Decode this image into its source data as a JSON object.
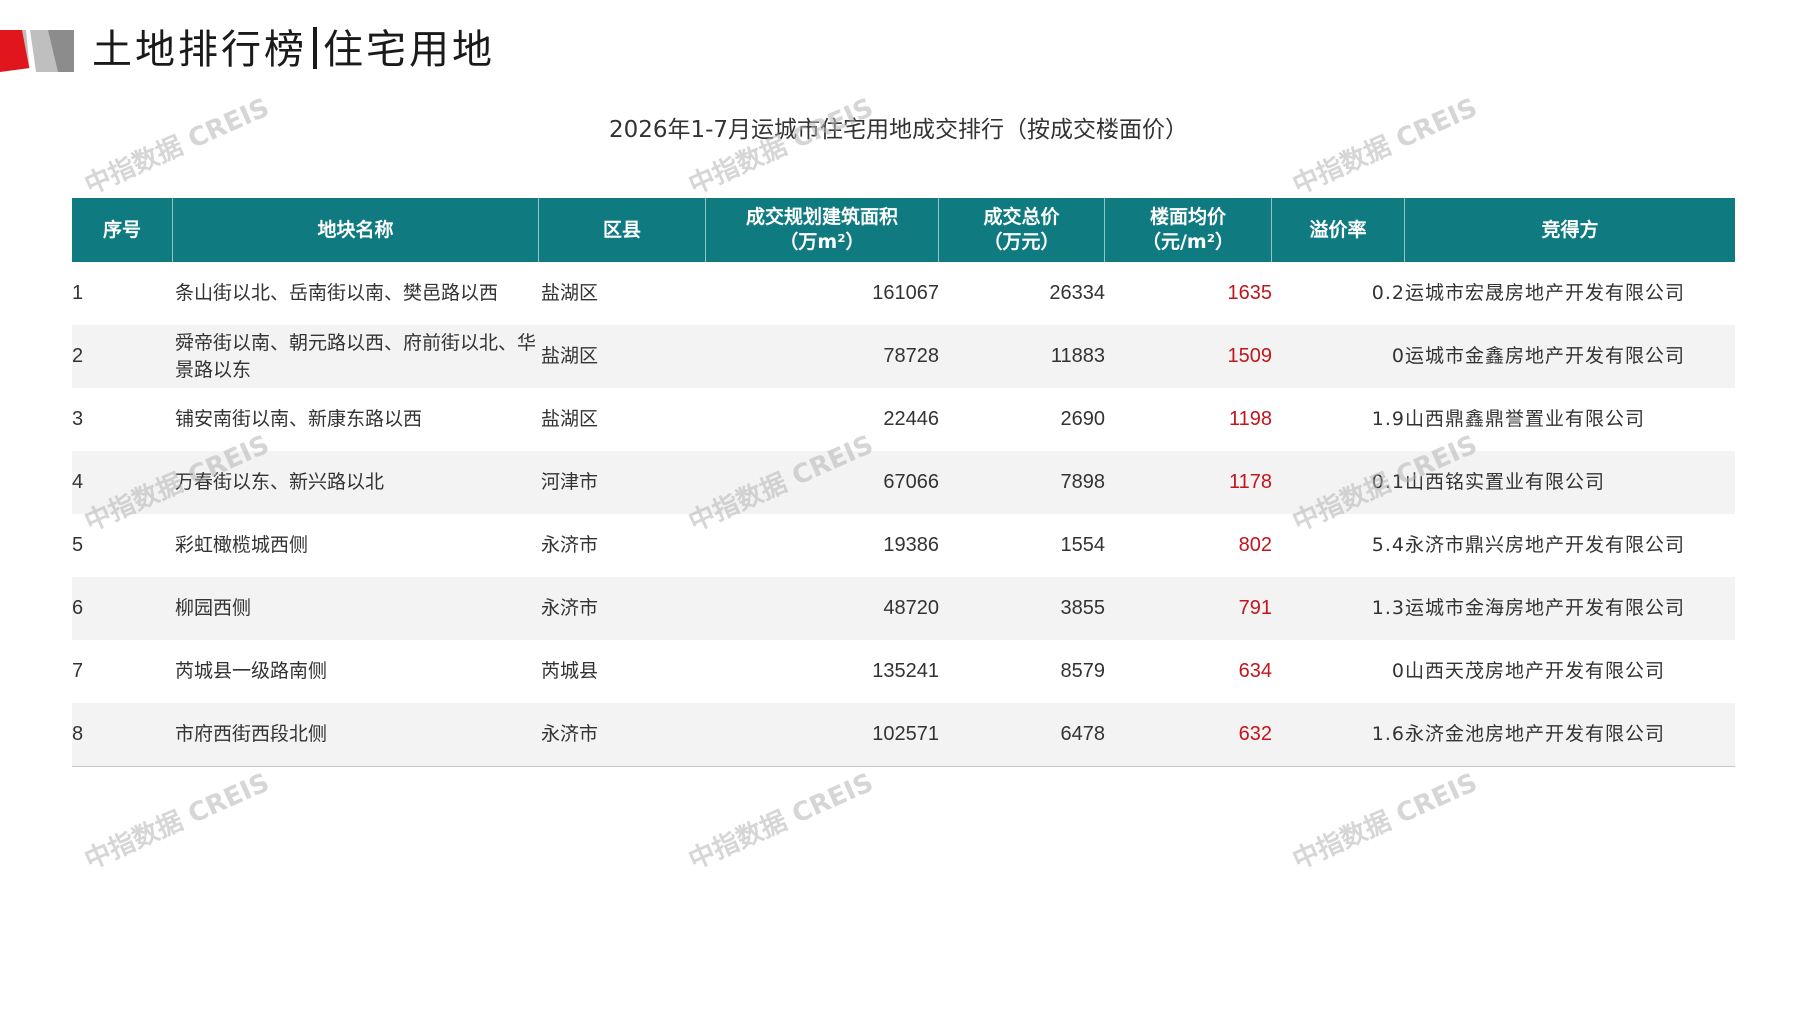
{
  "header": {
    "title_left": "土地排行榜",
    "title_right": "住宅用地",
    "accent_color": "#e0161c"
  },
  "caption": "2026年1-7月运城市住宅用地成交排行（按成交楼面价）",
  "table": {
    "header_color": "#0f7a80",
    "columns": [
      "序号",
      "地块名称",
      "区县",
      "成交规划建筑面积\n（万m²）",
      "成交总价\n（万元）",
      "楼面均价\n（元/m²）",
      "溢价率",
      "竞得方"
    ],
    "rows": [
      {
        "idx": "1",
        "name": "条山街以北、岳南街以南、樊邑路以西",
        "district": "盐湖区",
        "area": "161067",
        "total": "26334",
        "price": "1635",
        "rate": "0.2",
        "winner": "运城市宏晟房地产开发有限公司"
      },
      {
        "idx": "2",
        "name": "舜帝街以南、朝元路以西、府前街以北、华景路以东",
        "district": "盐湖区",
        "area": "78728",
        "total": "11883",
        "price": "1509",
        "rate": "0",
        "winner": "运城市金鑫房地产开发有限公司"
      },
      {
        "idx": "3",
        "name": "铺安南街以南、新康东路以西",
        "district": "盐湖区",
        "area": "22446",
        "total": "2690",
        "price": "1198",
        "rate": "1.9",
        "winner": "山西鼎鑫鼎誉置业有限公司"
      },
      {
        "idx": "4",
        "name": "万春街以东、新兴路以北",
        "district": "河津市",
        "area": "67066",
        "total": "7898",
        "price": "1178",
        "rate": "0.1",
        "winner": "山西铭实置业有限公司"
      },
      {
        "idx": "5",
        "name": "彩虹橄榄城西侧",
        "district": "永济市",
        "area": "19386",
        "total": "1554",
        "price": "802",
        "rate": "5.4",
        "winner": "永济市鼎兴房地产开发有限公司"
      },
      {
        "idx": "6",
        "name": "柳园西侧",
        "district": "永济市",
        "area": "48720",
        "total": "3855",
        "price": "791",
        "rate": "1.3",
        "winner": "运城市金海房地产开发有限公司"
      },
      {
        "idx": "7",
        "name": "芮城县一级路南侧",
        "district": "芮城县",
        "area": "135241",
        "total": "8579",
        "price": "634",
        "rate": "0",
        "winner": "山西天茂房地产开发有限公司"
      },
      {
        "idx": "8",
        "name": "市府西街西段北侧",
        "district": "永济市",
        "area": "102571",
        "total": "6478",
        "price": "632",
        "rate": "1.6",
        "winner": "永济金池房地产开发有限公司"
      }
    ]
  },
  "watermark": {
    "text": "中指数据 CREIS"
  }
}
